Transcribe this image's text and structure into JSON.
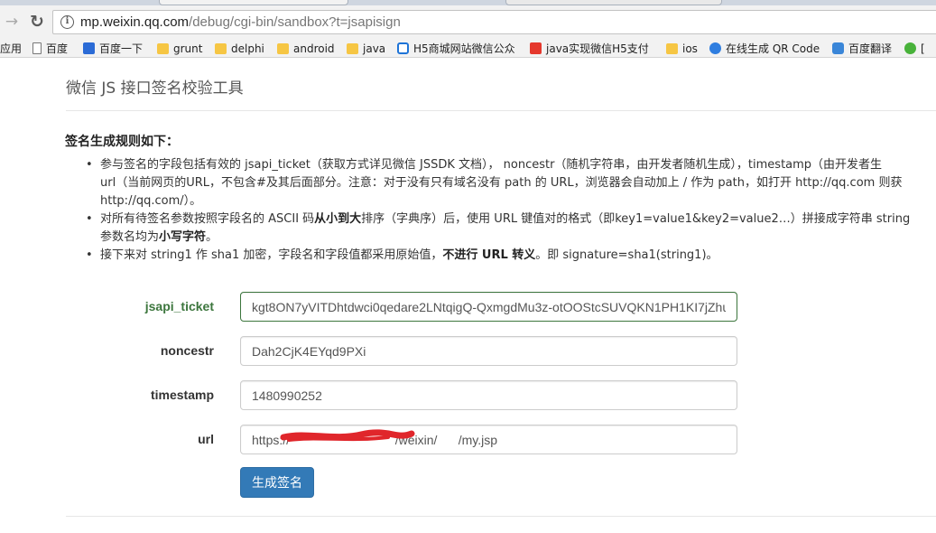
{
  "browser": {
    "url_host": "mp.weixin.qq.com",
    "url_path": "/debug/cgi-bin/sandbox?t=jsapisign",
    "bookmarks": [
      {
        "label": "应用",
        "icon": "none"
      },
      {
        "label": "百度",
        "icon": "page-icon"
      },
      {
        "label": "百度一下",
        "icon": "baidu-paw-icon"
      },
      {
        "label": "grunt",
        "icon": "folder-icon"
      },
      {
        "label": "delphi",
        "icon": "folder-icon"
      },
      {
        "label": "android",
        "icon": "folder-icon"
      },
      {
        "label": "java",
        "icon": "folder-icon"
      },
      {
        "label": "H5商城网站微信公众",
        "icon": "g-site-icon"
      },
      {
        "label": "java实现微信H5支付",
        "icon": "c-site-icon"
      },
      {
        "label": "ios",
        "icon": "folder-icon"
      },
      {
        "label": "在线生成 QR Code",
        "icon": "qr-site-icon"
      },
      {
        "label": "百度翻译",
        "icon": "translate-icon"
      },
      {
        "label": "[",
        "icon": "wechat-icon"
      }
    ]
  },
  "page": {
    "title": "微信 JS 接口签名校验工具",
    "rules_heading": "签名生成规则如下：",
    "rule1": {
      "line1": "参与签名的字段包括有效的 jsapi_ticket（获取方式详见微信 JSSDK 文档）， noncestr（随机字符串，由开发者随机生成），timestamp（由开发者生",
      "line2": "url（当前网页的URL，不包含#及其后面部分。注意：对于没有只有域名没有 path 的 URL，浏览器会自动加上 / 作为 path，如打开 http://qq.com 则获",
      "line3": "http://qq.com/）。"
    },
    "rule2": {
      "line1_a": "对所有待签名参数按照字段名的 ASCII 码",
      "line1_b": "从小到大",
      "line1_c": "排序（字典序）后，使用 URL 键值对的格式（即key1=value1&key2=value2…）拼接成字符串 string",
      "line2_a": "参数名均为",
      "line2_b": "小写字符",
      "line2_c": "。"
    },
    "rule3": {
      "part_a": "接下来对 string1 作 sha1 加密，字段名和字段值都采用原始值，",
      "part_b": "不进行 URL 转义",
      "part_c": "。即 signature=sha1(string1)。"
    }
  },
  "form": {
    "jsapi_ticket": {
      "label": "jsapi_ticket",
      "value": "kgt8ON7yVITDhtdwci0qedare2LNtqigQ-QxmgdMu3z-otOOStcSUVQKN1PH1KI7jZhu"
    },
    "noncestr": {
      "label": "noncestr",
      "value": "Dah2CjK4EYqd9PXi"
    },
    "timestamp": {
      "label": "timestamp",
      "value": "1480990252"
    },
    "url": {
      "label": "url",
      "value": "https://                              /weixin/      /my.jsp"
    },
    "submit_label": "生成签名"
  },
  "colors": {
    "primary": "#337ab7",
    "success": "#3c763d",
    "redaction": "#e0262b"
  }
}
